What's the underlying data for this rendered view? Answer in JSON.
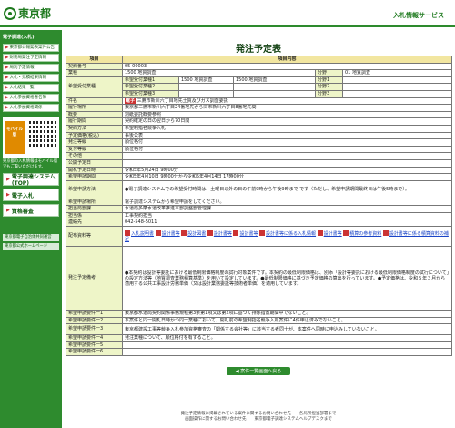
{
  "header": {
    "logo": "東京都",
    "service": "入札情報サービス"
  },
  "sidebar": {
    "head": "電子調達(入札)",
    "items": [
      "東京都公報発表案件公告",
      "財務局発注予定情報",
      "局別予定情報",
      "入札・見積結果情報",
      "入札結果一覧",
      "入札参加資格者名簿",
      "入札参加資格関係"
    ],
    "big": [
      "電子調達システム(TOP)",
      "電子入札",
      "資格審査"
    ],
    "mobile_label": "モバイル版",
    "mobile_text": "東京都の入札情報はモバイル版でもご覧いただけます。",
    "links": [
      "東京都電子自治体共同運営",
      "東京都公式ホームページ"
    ]
  },
  "page_title": "発注予定表",
  "table": {
    "col_item": "項目",
    "col_content": "項目内容",
    "rows": [
      {
        "label": "契約番号",
        "value": "05-00003"
      },
      {
        "label": "業種",
        "value": "1500 地質調査",
        "sub_label": "分野",
        "sub_value": "01 地質調査"
      }
    ],
    "kibou": {
      "label": "希望受付業種",
      "rows": [
        {
          "k": "希望受付業種1",
          "v1": "1500 地質調査",
          "v2": "1500 地質調査",
          "s": "分野1",
          "sv": ""
        },
        {
          "k": "希望受付業種2",
          "v1": "",
          "v2": "",
          "s": "分野2",
          "sv": ""
        },
        {
          "k": "希望受付業種3",
          "v1": "",
          "v2": "",
          "s": "分野3",
          "sv": ""
        }
      ]
    },
    "ken": {
      "label": "件名",
      "tag": "電子",
      "value": "三鷹市新川六丁目地先土質及びガス調査委託"
    },
    "rows2": [
      {
        "label": "履行場所",
        "value": "東京都三鷹市新川六丁目24番地先から同市新川六丁目8番地先間"
      },
      {
        "label": "概要",
        "value": "別紙委託概要参照"
      },
      {
        "label": "履行期間",
        "value": "契約確定の日の翌日から70日間"
      },
      {
        "label": "契約方法",
        "value": "希望制指名競争入札"
      },
      {
        "label": "予定価格(税込)",
        "value": "事後公表"
      },
      {
        "label": "発注等級",
        "value": "順位格付"
      },
      {
        "label": "受付等級",
        "value": "順位格付"
      },
      {
        "label": "その他",
        "value": ""
      },
      {
        "label": "公開予定日",
        "value": ""
      },
      {
        "label": "開札予定日時",
        "value": "令和5年5月24日 9時00分"
      },
      {
        "label": "希望申請期間",
        "value": "令和5年4月10日 9時00分から令和5年4月14日 17時00分"
      }
    ],
    "kibou_hoho": {
      "label": "希望申請方法",
      "value": "●電子調達システムでの希望受付時間は、土曜日以外の日の午前9時から午後9時まで です（ただし、希望申請期間最終日は午後5時まで）。"
    },
    "rows3": [
      {
        "label": "希望申請場所",
        "value": "電子調達システムから希望申請をしてください。"
      },
      {
        "label": "担当局部課",
        "value": "水道局多摩水道改革推進本部調整部管理課"
      },
      {
        "label": "担当係",
        "value": "工事契約担当"
      },
      {
        "label": "連絡先",
        "value": "042-548-5011"
      }
    ],
    "docs": {
      "label": "配布資料等",
      "items": [
        "入札説明書",
        "設計書等",
        "設計図書",
        "設計書等",
        "設計書等",
        "設計書等に係る入札情報",
        "設計書等",
        "積算の参考資料",
        "設計書等に係る積算資料の補足"
      ]
    },
    "biko": {
      "label": "発注予定備考",
      "value": "●本契約は設計等委託における最低制限価格制度の試行対象案件です。本契約の最低制限価格は、別添「設計等委託における最低制限価格制度の試行について」の設定方法等（地質調査業務積算基準）を用いて設定しています。●最低制限価格に基づき予定価格の算出を行っています。●予定価格は、令和５年３月から適用する公共工事設計労務単価（又は設計業務委託等技術者単価）を適用しています。"
    },
    "notes": [
      {
        "label": "希望申請要件一1",
        "value": "東京都水道局契約関係事務規程第3条第1項又は第2項に基づく排除措置期間中でないこと。"
      },
      {
        "label": "希望申請要件一2",
        "value": "本案件と同一開札日時かつ同一業種において、開札前の希望制指名競争入札案件に4件申込済みでないこと。"
      },
      {
        "label": "希望申請要件一3",
        "value": "東京都建設工事等競争入札参加資格審査の「関係する会社等」に該当する者同士が、本案件へ同時に申込みしていないこと。"
      },
      {
        "label": "希望申請要件一4",
        "value": "発注業種について、順位格付を有すること。"
      },
      {
        "label": "希望申請要件一5",
        "value": ""
      },
      {
        "label": "希望申請要件一6",
        "value": ""
      }
    ]
  },
  "back_button": "◀ 案件一覧画面へ戻る",
  "footer": {
    "line1": "発注予定情報に掲載されている案件に関するお問い合わせ先　　各局所担当部署まで",
    "line2": "画面操作に関するお問い合わせ先　　東京都電子調達システムヘルプデスクまで"
  }
}
